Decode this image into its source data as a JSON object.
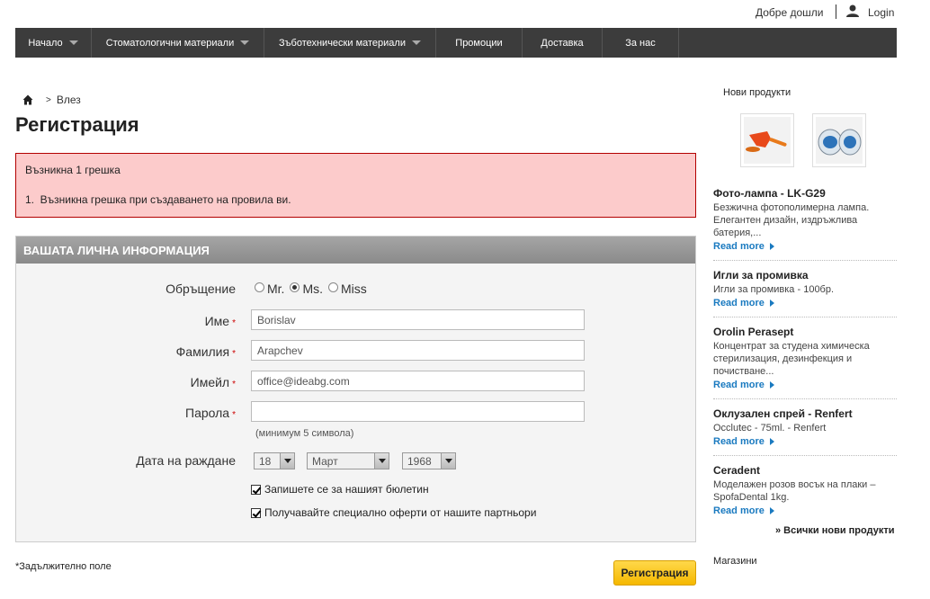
{
  "topbar": {
    "welcome": "Добре дошли",
    "login": "Login"
  },
  "nav": {
    "items": [
      {
        "label": "Начало",
        "dropdown": true
      },
      {
        "label": "Стоматологични материали",
        "dropdown": true
      },
      {
        "label": "Зъботехнически материали",
        "dropdown": true
      },
      {
        "label": "Промоции",
        "dropdown": false
      },
      {
        "label": "Доставка",
        "dropdown": false
      },
      {
        "label": "За нас",
        "dropdown": false
      }
    ]
  },
  "breadcrumb": {
    "sep": ">",
    "current": "Влез"
  },
  "page_title": "Регистрация",
  "error": {
    "title": "Възникна 1 грешка",
    "items": [
      "1.  Възникна грешка при създаването на провила ви."
    ]
  },
  "form": {
    "section_title": "ВАШАТА ЛИЧНА ИНФОРМАЦИЯ",
    "salutation_label": "Обръщение",
    "salutations": [
      {
        "label": "Mr.",
        "checked": false
      },
      {
        "label": "Ms.",
        "checked": true
      },
      {
        "label": "Miss",
        "checked": false
      }
    ],
    "first_name_label": "Име",
    "first_name_value": "Borislav",
    "last_name_label": "Фамилия",
    "last_name_value": "Arapchev",
    "email_label": "Имейл",
    "email_value": "office@ideabg.com",
    "password_label": "Парола",
    "password_value": "",
    "password_hint": "(минимум 5 символа)",
    "birthdate_label": "Дата на раждане",
    "birth_day": "18",
    "birth_month": "Март",
    "birth_year": "1968",
    "required_mark": "*",
    "newsletter_label": "Запишете се за нашият бюлетин",
    "newsletter_checked": true,
    "partners_label": "Получавайте специално оферти от нашите партньори",
    "partners_checked": true
  },
  "required_note": "*Задължително поле",
  "submit_label": "Регистрация",
  "sidebar": {
    "title": "Нови продукти",
    "products": [
      {
        "name": "Фото-лампа - LK-G29",
        "desc": "Безжична фотополимерна лампа. Елегантен дизайн, издръжлива батерия,...",
        "more": "Read more"
      },
      {
        "name": "Игли за промивка",
        "desc": "Игли за промивка - 100бр.",
        "more": "Read more"
      },
      {
        "name": "Orolin Perasept",
        "desc": "Концентрат за студена химическа стерилизация, дезинфекция и почистване...",
        "more": "Read more"
      },
      {
        "name": "Оклузален спрей - Renfert",
        "desc": "Occlutec - 75ml. - Renfert",
        "more": "Read more"
      },
      {
        "name": "Ceradent",
        "desc": "Моделажен розов восък на плаки – SpofaDental 1kg.",
        "more": "Read more"
      }
    ],
    "all_new": "» Всички нови продукти",
    "shops": "Магазини"
  },
  "colors": {
    "nav_bg": "#3c3c3c",
    "error_bg": "#fccbcb",
    "error_border": "#b30000",
    "button": "#f5b800",
    "link": "#1a7ac0"
  }
}
